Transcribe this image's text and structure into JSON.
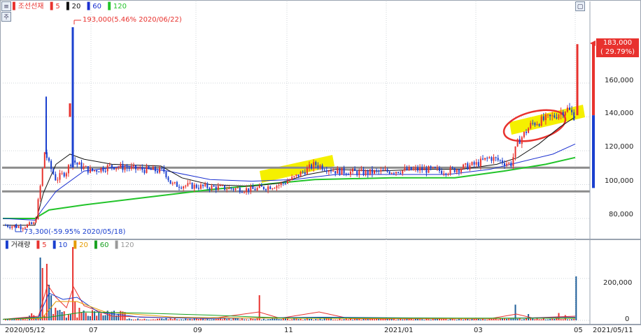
{
  "legend": {
    "name": "조선선재",
    "ma5": "5",
    "ma20": "20",
    "ma60": "60",
    "ma120": "120"
  },
  "colors": {
    "up": "#e8322e",
    "down": "#1a3fcf",
    "ma5": "#e8322e",
    "ma20": "#111111",
    "ma60": "#1a2fd0",
    "ma120": "#22c42a",
    "highlight": "#f5f000",
    "hline": "#8c8c8c"
  },
  "annotations": {
    "high": "193,000(5.46% 2020/06/22)",
    "low": "73,300(-59.95% 2020/05/18)",
    "current_price": "183,000",
    "current_change": "( 29.79%)"
  },
  "price_axis": [
    "160,000",
    "140,000",
    "120,000",
    "100,000",
    "80,000"
  ],
  "volume_legend": {
    "name": "거래량",
    "v5": "5",
    "v10": "10",
    "v20": "20",
    "v60": "60",
    "v120": "120"
  },
  "volume_axis": [
    "200,000",
    "0"
  ],
  "x_axis": [
    "2020/05/12",
    "07",
    "09",
    "11",
    "2021/01",
    "03",
    "05",
    "2021/05/11"
  ],
  "chart_data": {
    "type": "candlestick",
    "price_ylim": [
      65000,
      193000
    ],
    "support_lines": [
      110000,
      96000
    ],
    "high": {
      "value": 193000,
      "date": "2020/06/22"
    },
    "low": {
      "value": 73300,
      "date": "2020/05/18"
    },
    "last": {
      "value": 183000,
      "change_pct": 29.79
    },
    "volume_ylim": [
      0,
      360000
    ]
  }
}
